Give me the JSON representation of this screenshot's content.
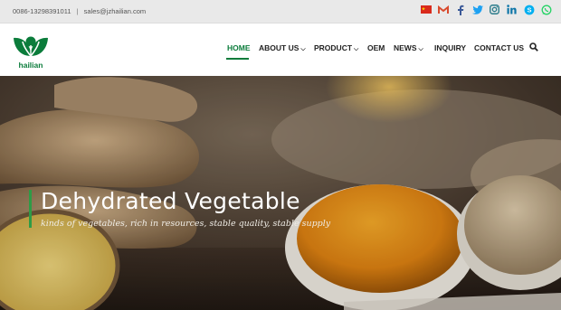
{
  "topbar": {
    "phone": "0086-13298391011",
    "separator": "|",
    "email": "sales@jzhailian.com",
    "social_icons": [
      "chinese-flag-icon",
      "gmail-icon",
      "facebook-icon",
      "twitter-icon",
      "instagram-icon",
      "linkedin-icon",
      "skype-icon",
      "whatsapp-icon"
    ]
  },
  "brand": {
    "logo_text": "hailian",
    "color": "#0b7c3b"
  },
  "nav": {
    "home": "HOME",
    "about": "ABOUT US",
    "product": "PRODUCT",
    "oem": "OEM",
    "news": "NEWS",
    "inquiry": "INQUIRY",
    "contact": "CONTACT US",
    "active": "HOME"
  },
  "hero": {
    "title": "Dehydrated Vegetable",
    "subtitle": "kinds of vegetables, rich in resources, stable quality, stable supply"
  },
  "colors": {
    "accent": "#0b7c3b",
    "topbar_bg": "#e9e9e9"
  }
}
